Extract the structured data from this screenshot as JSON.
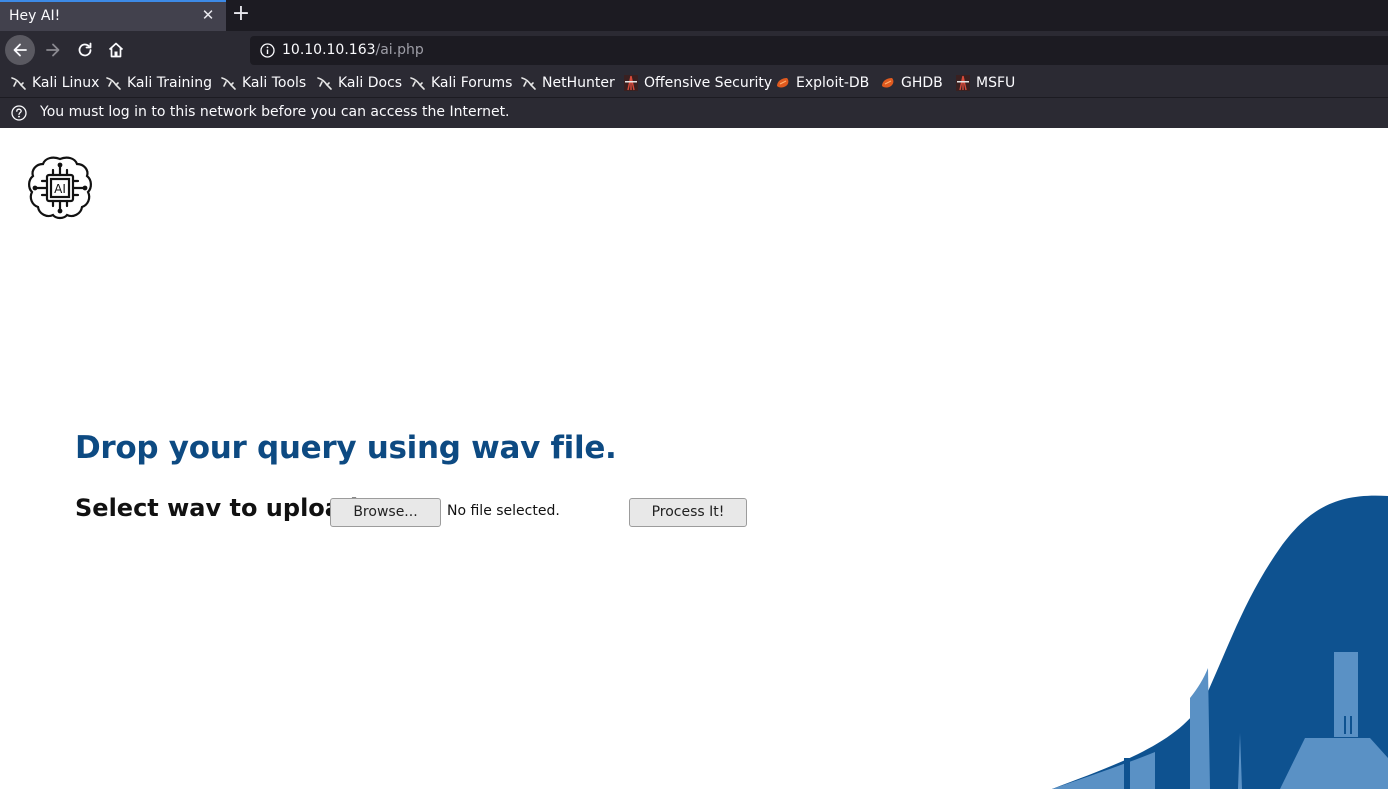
{
  "browser": {
    "tab_title": "Hey AI!",
    "url_host": "10.10.10.163",
    "url_path": "/ai.php",
    "notice": "You must log in to this network before you can access the Internet."
  },
  "bookmarks": [
    {
      "label": "Kali Linux",
      "icon": "kali-dragon-icon"
    },
    {
      "label": "Kali Training",
      "icon": "kali-dragon-icon"
    },
    {
      "label": "Kali Tools",
      "icon": "kali-dragon-icon"
    },
    {
      "label": "Kali Docs",
      "icon": "kali-dragon-icon"
    },
    {
      "label": "Kali Forums",
      "icon": "kali-dragon-icon"
    },
    {
      "label": "NetHunter",
      "icon": "kali-dragon-icon"
    },
    {
      "label": "Offensive Security",
      "icon": "offsec-icon"
    },
    {
      "label": "Exploit-DB",
      "icon": "exploitdb-icon"
    },
    {
      "label": "GHDB",
      "icon": "exploitdb-icon"
    },
    {
      "label": "MSFU",
      "icon": "offsec-icon"
    }
  ],
  "page": {
    "logo_text": "AI",
    "heading": "Drop your query using wav file.",
    "upload_label": "Select wav to upload:",
    "browse_label": "Browse...",
    "file_status": "No file selected.",
    "submit_label": "Process It!"
  },
  "colors": {
    "heading": "#0d4a82",
    "wave_dark": "#0e5290",
    "wave_light": "#5a91c5"
  }
}
